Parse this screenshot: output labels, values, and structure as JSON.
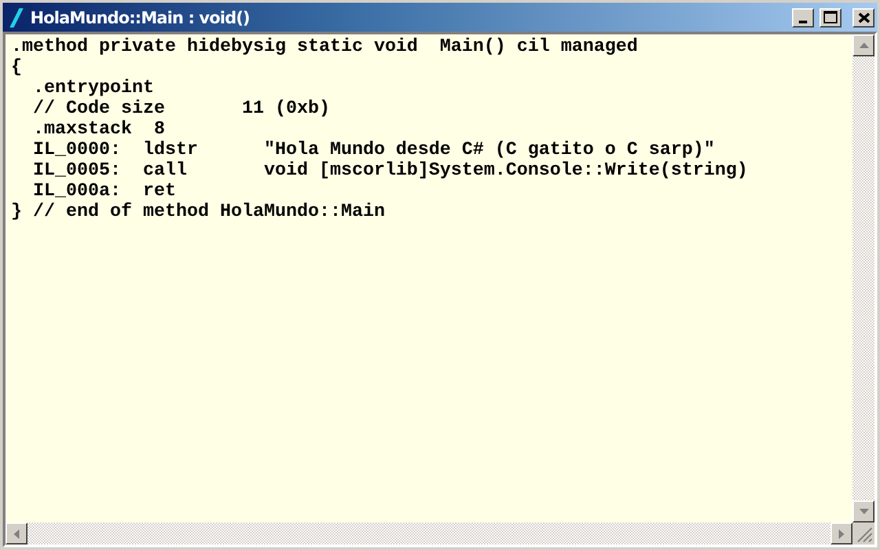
{
  "window": {
    "title": "HolaMundo::Main : void()"
  },
  "code_lines": [
    ".method private hidebysig static void  Main() cil managed",
    "{",
    "  .entrypoint",
    "  // Code size       11 (0xb)",
    "  .maxstack  8",
    "  IL_0000:  ldstr      \"Hola Mundo desde C# (C gatito o C sarp)\"",
    "  IL_0005:  call       void [mscorlib]System.Console::Write(string)",
    "  IL_000a:  ret",
    "} // end of method HolaMundo::Main"
  ]
}
